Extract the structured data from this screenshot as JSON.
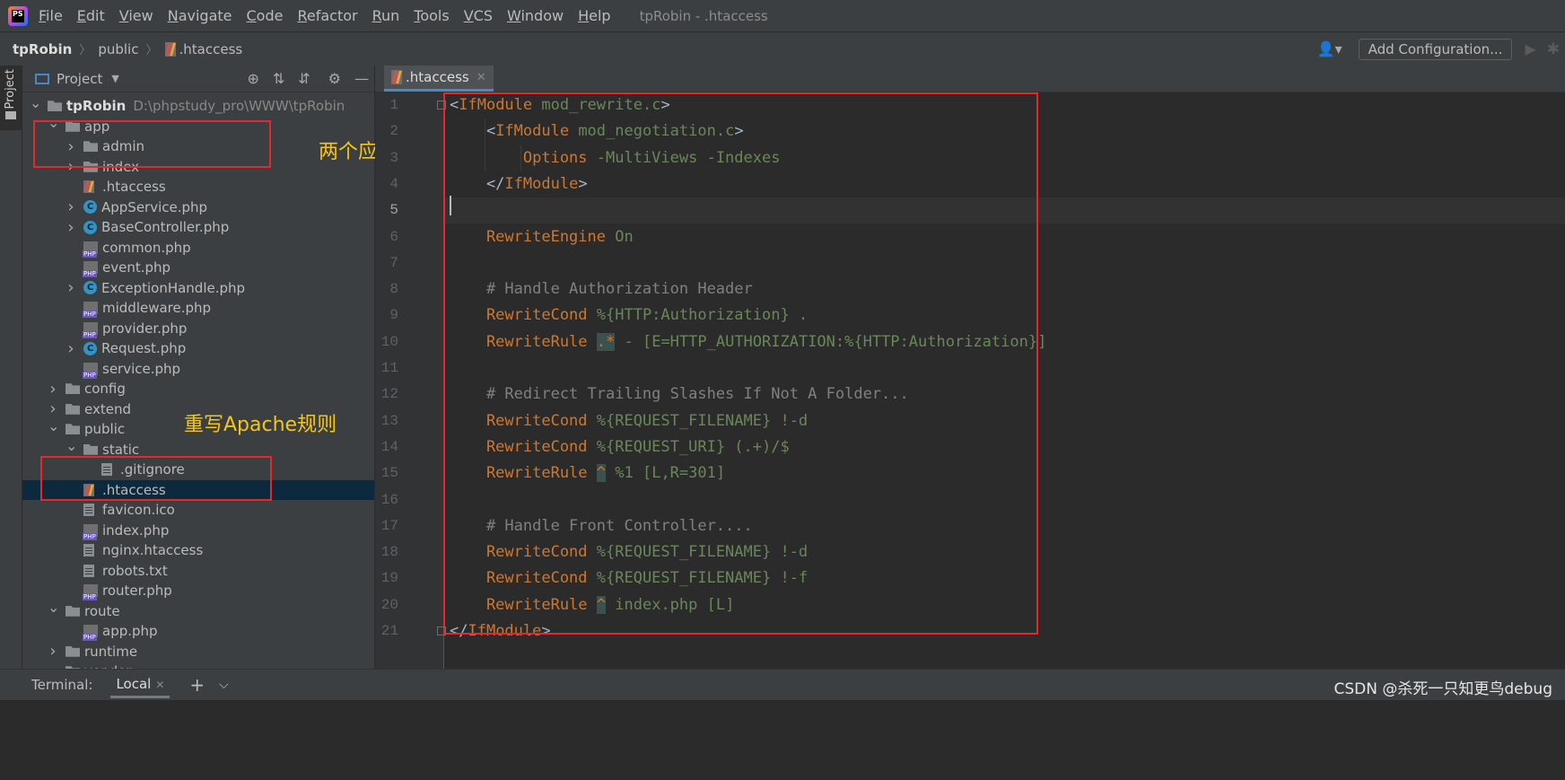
{
  "menubar": {
    "items": [
      {
        "u": "F",
        "rest": "ile"
      },
      {
        "u": "E",
        "rest": "dit"
      },
      {
        "u": "V",
        "rest": "iew"
      },
      {
        "u": "N",
        "rest": "avigate"
      },
      {
        "u": "C",
        "rest": "ode"
      },
      {
        "u": "R",
        "rest": "efactor"
      },
      {
        "u": "R",
        "rest": "un"
      },
      {
        "u": "T",
        "rest": "ools"
      },
      {
        "u": "V",
        "rest": "CS"
      },
      {
        "u": "W",
        "rest": "indow"
      },
      {
        "u": "H",
        "rest": "elp"
      }
    ],
    "window_title": "tpRobin - .htaccess",
    "logo_text": "PS"
  },
  "navbar": {
    "crumbs": [
      "tpRobin",
      "public",
      ".htaccess"
    ],
    "add_configuration": "Add Configuration..."
  },
  "toolstrip": {
    "project_label": "Project"
  },
  "project_panel": {
    "title": "Project",
    "root_path": "D:\\phpstudy_pro\\WWW\\tpRobin",
    "tree": [
      {
        "depth": 0,
        "chev": "v",
        "icon": "folder",
        "label": "tpRobin",
        "bold": true
      },
      {
        "depth": 1,
        "chev": "v",
        "icon": "folder",
        "label": "app"
      },
      {
        "depth": 2,
        "chev": ">",
        "icon": "folder",
        "label": "admin"
      },
      {
        "depth": 2,
        "chev": ">",
        "icon": "folder",
        "label": "index"
      },
      {
        "depth": 2,
        "chev": "",
        "icon": "hta",
        "label": ".htaccess"
      },
      {
        "depth": 2,
        "chev": ">",
        "icon": "cls",
        "label": "AppService.php"
      },
      {
        "depth": 2,
        "chev": ">",
        "icon": "cls",
        "label": "BaseController.php"
      },
      {
        "depth": 2,
        "chev": "",
        "icon": "php",
        "label": "common.php"
      },
      {
        "depth": 2,
        "chev": "",
        "icon": "php",
        "label": "event.php"
      },
      {
        "depth": 2,
        "chev": ">",
        "icon": "cls",
        "label": "ExceptionHandle.php"
      },
      {
        "depth": 2,
        "chev": "",
        "icon": "php",
        "label": "middleware.php"
      },
      {
        "depth": 2,
        "chev": "",
        "icon": "php",
        "label": "provider.php"
      },
      {
        "depth": 2,
        "chev": ">",
        "icon": "cls",
        "label": "Request.php"
      },
      {
        "depth": 2,
        "chev": "",
        "icon": "php",
        "label": "service.php"
      },
      {
        "depth": 1,
        "chev": ">",
        "icon": "folder",
        "label": "config"
      },
      {
        "depth": 1,
        "chev": ">",
        "icon": "folder",
        "label": "extend"
      },
      {
        "depth": 1,
        "chev": "v",
        "icon": "folder",
        "label": "public"
      },
      {
        "depth": 2,
        "chev": "v",
        "icon": "folder",
        "label": "static"
      },
      {
        "depth": 3,
        "chev": "",
        "icon": "txt",
        "label": ".gitignore"
      },
      {
        "depth": 2,
        "chev": "",
        "icon": "hta",
        "label": ".htaccess",
        "selected": true
      },
      {
        "depth": 2,
        "chev": "",
        "icon": "txt",
        "label": "favicon.ico"
      },
      {
        "depth": 2,
        "chev": "",
        "icon": "php",
        "label": "index.php"
      },
      {
        "depth": 2,
        "chev": "",
        "icon": "txt",
        "label": "nginx.htaccess"
      },
      {
        "depth": 2,
        "chev": "",
        "icon": "txt",
        "label": "robots.txt"
      },
      {
        "depth": 2,
        "chev": "",
        "icon": "php",
        "label": "router.php"
      },
      {
        "depth": 1,
        "chev": "v",
        "icon": "folder",
        "label": "route"
      },
      {
        "depth": 2,
        "chev": "",
        "icon": "php",
        "label": "app.php"
      },
      {
        "depth": 1,
        "chev": ">",
        "icon": "folder",
        "label": "runtime"
      },
      {
        "depth": 1,
        "chev": ">",
        "icon": "folder",
        "label": "vendor"
      }
    ]
  },
  "annotations": {
    "apps": "两个应用",
    "rewrite": "重写Apache规则"
  },
  "editor": {
    "tab_label": ".htaccess",
    "current_line": 5,
    "lines": [
      [
        [
          "<",
          "k-gray"
        ],
        [
          "IfModule",
          "k-orange"
        ],
        [
          " mod_rewrite.c",
          "k-green"
        ],
        [
          ">",
          "k-gray"
        ]
      ],
      [
        [
          "    <",
          "k-gray"
        ],
        [
          "IfModule",
          "k-orange"
        ],
        [
          " mod_negotiation.c",
          "k-green"
        ],
        [
          ">",
          "k-gray"
        ]
      ],
      [
        [
          "        Options",
          "k-orange"
        ],
        [
          " -MultiViews -Indexes",
          "k-green"
        ]
      ],
      [
        [
          "    </",
          "k-gray"
        ],
        [
          "IfModule",
          "k-orange"
        ],
        [
          ">",
          "k-gray"
        ]
      ],
      [
        [
          "",
          ""
        ]
      ],
      [
        [
          "    RewriteEngine",
          "k-orange"
        ],
        [
          " On",
          "k-green"
        ]
      ],
      [
        [
          "",
          ""
        ]
      ],
      [
        [
          "    # Handle Authorization Header",
          "k-comment"
        ]
      ],
      [
        [
          "    RewriteCond",
          "k-orange"
        ],
        [
          " %{HTTP:Authorization} .",
          "k-green"
        ]
      ],
      [
        [
          "    RewriteRule",
          "k-orange"
        ],
        [
          " ",
          "k-green"
        ],
        [
          ".*",
          "k-rx"
        ],
        [
          " - [E=HTTP_AUTHORIZATION:%{HTTP:Authorization}]",
          "k-green"
        ]
      ],
      [
        [
          "",
          ""
        ]
      ],
      [
        [
          "    # Redirect Trailing Slashes If Not A Folder...",
          "k-comment"
        ]
      ],
      [
        [
          "    RewriteCond",
          "k-orange"
        ],
        [
          " %{REQUEST_FILENAME} !-d",
          "k-green"
        ]
      ],
      [
        [
          "    RewriteCond",
          "k-orange"
        ],
        [
          " %{REQUEST_URI} (.+)/$",
          "k-green"
        ]
      ],
      [
        [
          "    RewriteRule",
          "k-orange"
        ],
        [
          " ",
          "k-green"
        ],
        [
          "^",
          "k-rx"
        ],
        [
          " %1 [L,R=301]",
          "k-green"
        ]
      ],
      [
        [
          "",
          ""
        ]
      ],
      [
        [
          "    # Handle Front Controller....",
          "k-comment"
        ]
      ],
      [
        [
          "    RewriteCond",
          "k-orange"
        ],
        [
          " %{REQUEST_FILENAME} !-d",
          "k-green"
        ]
      ],
      [
        [
          "    RewriteCond",
          "k-orange"
        ],
        [
          " %{REQUEST_FILENAME} !-f",
          "k-green"
        ]
      ],
      [
        [
          "    RewriteRule",
          "k-orange"
        ],
        [
          " ",
          "k-green"
        ],
        [
          "^",
          "k-rx"
        ],
        [
          " index.php [L]",
          "k-green"
        ]
      ],
      [
        [
          "</",
          "k-gray"
        ],
        [
          "IfModule",
          "k-orange"
        ],
        [
          ">",
          "k-gray"
        ]
      ]
    ]
  },
  "bottombar": {
    "terminal_label": "Terminal:",
    "local_tab": "Local",
    "watermark": "CSDN @杀死一只知更鸟debug"
  },
  "colors": {
    "annotation_box": "#e3292b",
    "annotation_text": "#f5c518",
    "keyword": "#cc7832",
    "string": "#6a8759",
    "comment": "#808080"
  }
}
